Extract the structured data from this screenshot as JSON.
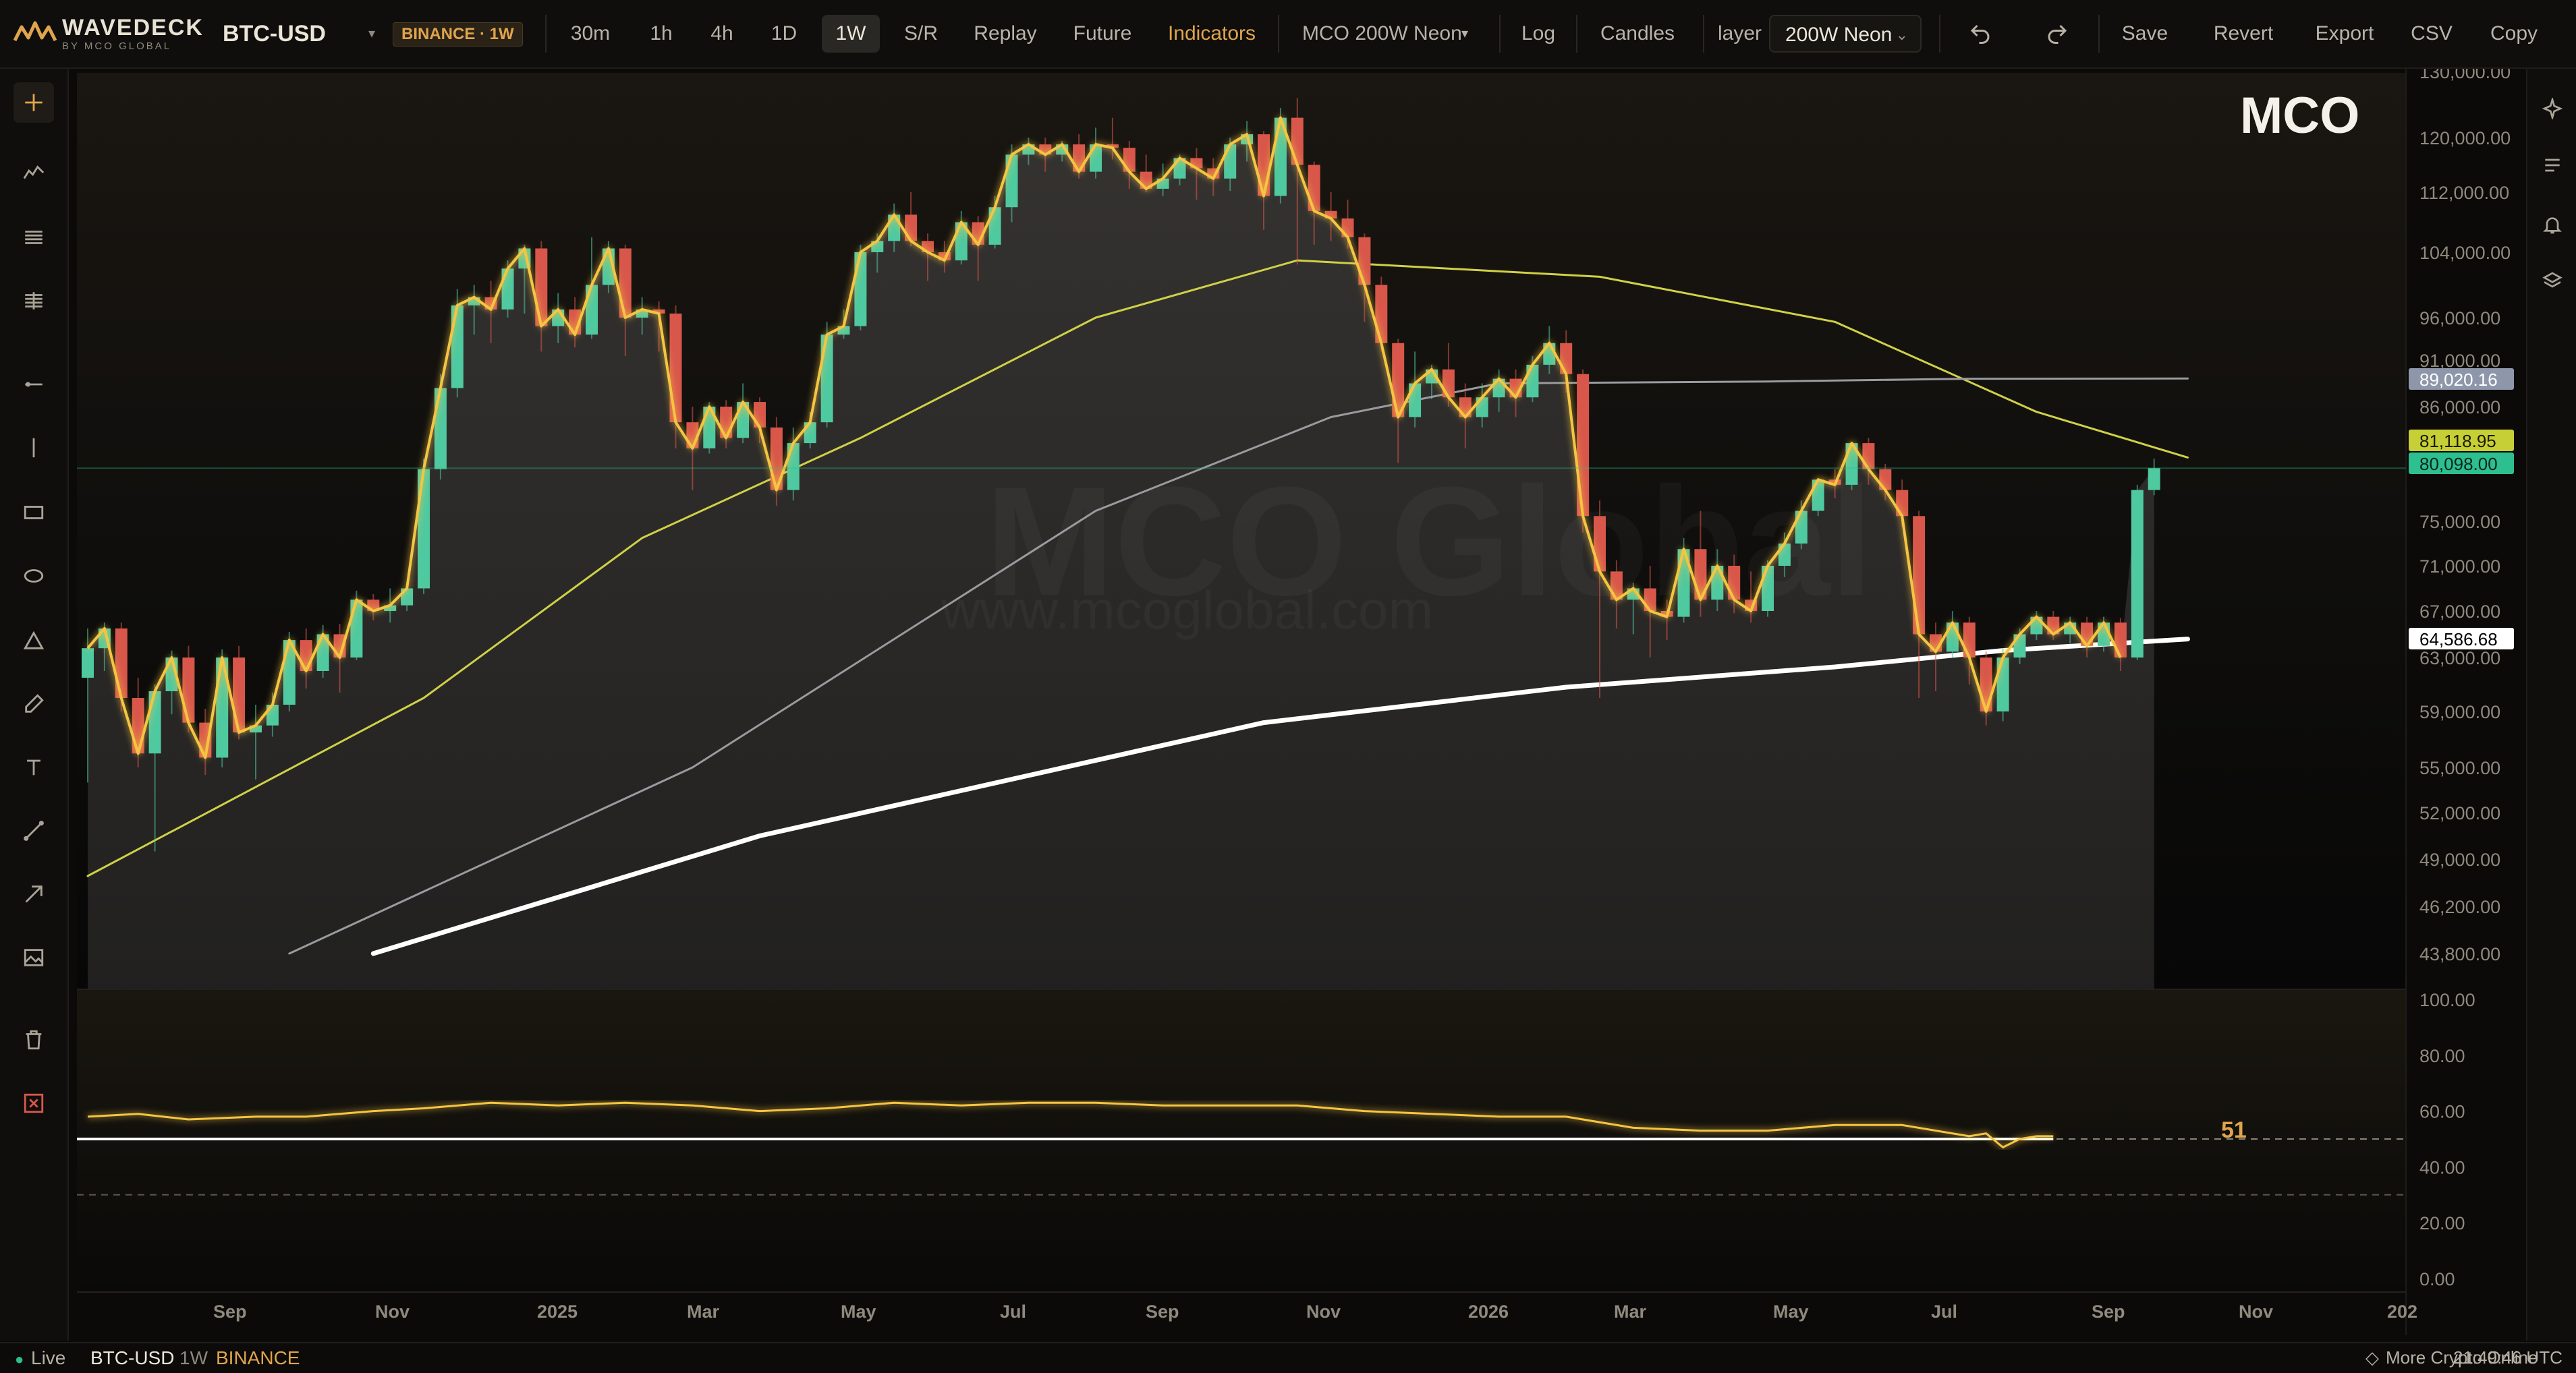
{
  "app": {
    "brand_name": "WAVEDECK",
    "brand_tagline": "BY MCO GLOBAL",
    "symbol": "BTC-USD",
    "exchange_badge": "BINANCE · 1W"
  },
  "toolbar": {
    "timeframes": [
      "30m",
      "1h",
      "4h",
      "1D",
      "1W"
    ],
    "active_timeframe": "1W",
    "buttons": {
      "sr": "S/R",
      "replay": "Replay",
      "future": "Future",
      "indicators": "Indicators"
    },
    "indicator_select": "MCO 200W Neon",
    "log": "Log",
    "candles": "Candles",
    "layer_label": "layer",
    "layer_value": "200W Neon",
    "save": "Save",
    "revert": "Revert",
    "export": "Export",
    "csv": "CSV",
    "copy": "Copy"
  },
  "left_tools": [
    "crosshair-icon",
    "polyline-icon",
    "horizontal-lines-icon",
    "fib-icon",
    "ray-icon",
    "vertical-line-icon",
    "rectangle-icon",
    "ellipse-icon",
    "triangle-icon",
    "brush-icon",
    "text-icon",
    "trendline-icon",
    "arrow-icon",
    "image-icon",
    "trash-icon",
    "close-icon"
  ],
  "right_tools": [
    "sparkle-icon",
    "list-icon",
    "bell-icon",
    "layers-icon"
  ],
  "colors": {
    "accent": "#e0a54c",
    "up_candle": "#4fc9a0",
    "down_candle": "#d8574a",
    "neon_line": "#f5c542",
    "ma_fast": "#cfd147",
    "ma_mid": "#9a9aa0",
    "ma_slow": "#ffffff",
    "tag_blue": "#8e97aa",
    "tag_green": "#2dbf8f",
    "tag_lime": "#c6cf35"
  },
  "watermark": {
    "logo": "MCO",
    "big": "MCO Global",
    "url": "www.mcoglobal.com"
  },
  "chart_data": {
    "type": "candlestick",
    "symbol": "BTC-USD",
    "interval": "1W",
    "exchange": "BINANCE",
    "price_axis_labels": [
      "130,000.00",
      "120,000.00",
      "112,000.00",
      "104,000.00",
      "96,000.00",
      "91,000.00",
      "86,000.00",
      "75,000.00",
      "71,000.00",
      "67,000.00",
      "63,000.00",
      "59,000.00",
      "55,000.00",
      "52,000.00",
      "49,000.00",
      "46,200.00",
      "43,800.00"
    ],
    "time_axis_labels": [
      "Sep",
      "Nov",
      "2025",
      "Mar",
      "May",
      "Jul",
      "Sep",
      "Nov",
      "2026",
      "Mar",
      "May",
      "Jul",
      "Sep",
      "Nov",
      "202"
    ],
    "ylim": [
      43800,
      130000
    ],
    "price_tags": [
      {
        "value": "89,020.16",
        "color": "#8e97aa",
        "text_color": "#ffffff"
      },
      {
        "value": "81,118.95",
        "color": "#c6cf35",
        "text_color": "#1a1a00"
      },
      {
        "value": "80,098.00",
        "color": "#2dbf8f",
        "text_color": "#06261b"
      },
      {
        "value": "64,586.68",
        "color": "#ffffff",
        "text_color": "#000000"
      }
    ],
    "last_price": 80098,
    "moving_averages": [
      {
        "color": "#cfd147",
        "points": [
          [
            0,
            48000
          ],
          [
            20,
            60000
          ],
          [
            33,
            73500
          ],
          [
            46,
            83000
          ],
          [
            60,
            96000
          ],
          [
            72,
            103000
          ],
          [
            90,
            101000
          ],
          [
            104,
            95500
          ],
          [
            116,
            85500
          ],
          [
            125,
            81119
          ]
        ]
      },
      {
        "color": "#9a9aa0",
        "points": [
          [
            12,
            43800
          ],
          [
            36,
            55000
          ],
          [
            60,
            76000
          ],
          [
            74,
            85000
          ],
          [
            84,
            88500
          ],
          [
            100,
            88700
          ],
          [
            112,
            89000
          ],
          [
            125,
            89020
          ]
        ]
      },
      {
        "color": "#ffffff",
        "points": [
          [
            17,
            43800
          ],
          [
            40,
            50500
          ],
          [
            70,
            58200
          ],
          [
            88,
            60800
          ],
          [
            104,
            62300
          ],
          [
            114,
            63600
          ],
          [
            125,
            64587
          ]
        ]
      }
    ],
    "candles": [
      [
        0,
        61500,
        63800,
        54000,
        65500
      ],
      [
        1,
        63800,
        65500,
        62000,
        66000
      ],
      [
        2,
        65500,
        60000,
        59000,
        66000
      ],
      [
        3,
        60000,
        56000,
        55000,
        61500
      ],
      [
        4,
        56000,
        60500,
        49500,
        61000
      ],
      [
        5,
        60500,
        63000,
        58800,
        63600
      ],
      [
        6,
        63000,
        58200,
        57500,
        64000
      ],
      [
        7,
        58200,
        55700,
        54500,
        59200
      ],
      [
        8,
        55700,
        63000,
        55000,
        63700
      ],
      [
        9,
        63000,
        57500,
        57000,
        64000
      ],
      [
        10,
        57500,
        58000,
        54200,
        59500
      ],
      [
        11,
        58000,
        59500,
        57200,
        60400
      ],
      [
        12,
        59500,
        64500,
        59000,
        65200
      ],
      [
        13,
        64500,
        62000,
        60700,
        65500
      ],
      [
        14,
        62000,
        65000,
        61500,
        65800
      ],
      [
        15,
        65000,
        63000,
        60400,
        65900
      ],
      [
        16,
        63000,
        68000,
        62800,
        68800
      ],
      [
        17,
        68000,
        67000,
        66200,
        68500
      ],
      [
        18,
        67000,
        67500,
        66000,
        69000
      ],
      [
        19,
        67500,
        69000,
        67000,
        69500
      ],
      [
        20,
        69000,
        80000,
        68500,
        81000
      ],
      [
        21,
        80000,
        88000,
        79000,
        89500
      ],
      [
        22,
        88000,
        97500,
        87000,
        99500
      ],
      [
        23,
        97500,
        98500,
        94000,
        100000
      ],
      [
        24,
        98500,
        97000,
        93000,
        100500
      ],
      [
        25,
        97000,
        102000,
        96000,
        103000
      ],
      [
        26,
        102000,
        104500,
        96500,
        105000
      ],
      [
        27,
        104500,
        95000,
        92000,
        105500
      ],
      [
        28,
        95000,
        97000,
        93000,
        99000
      ],
      [
        29,
        97000,
        94000,
        92500,
        98500
      ],
      [
        30,
        94000,
        100000,
        93500,
        106000
      ],
      [
        31,
        100000,
        104500,
        99000,
        105500
      ],
      [
        32,
        104500,
        96000,
        91500,
        105000
      ],
      [
        33,
        96000,
        97000,
        94000,
        98500
      ],
      [
        34,
        97000,
        96500,
        92000,
        98000
      ],
      [
        35,
        96500,
        84500,
        82000,
        97500
      ],
      [
        36,
        84500,
        82000,
        78000,
        86000
      ],
      [
        37,
        82000,
        86000,
        81500,
        86500
      ],
      [
        38,
        86000,
        83000,
        82000,
        86700
      ],
      [
        39,
        83000,
        86500,
        82500,
        88500
      ],
      [
        40,
        86500,
        84000,
        82500,
        87000
      ],
      [
        41,
        84000,
        78000,
        76500,
        85000
      ],
      [
        42,
        78000,
        82500,
        77000,
        84000
      ],
      [
        43,
        82500,
        84500,
        82000,
        85500
      ],
      [
        44,
        84500,
        94000,
        84000,
        95500
      ],
      [
        45,
        94000,
        95000,
        93500,
        97000
      ],
      [
        46,
        95000,
        104000,
        94500,
        105000
      ],
      [
        47,
        104000,
        105500,
        101500,
        106500
      ],
      [
        48,
        105500,
        109000,
        104000,
        110500
      ],
      [
        49,
        109000,
        105500,
        104800,
        112000
      ],
      [
        50,
        105500,
        104000,
        100500,
        106500
      ],
      [
        51,
        104000,
        103000,
        101500,
        105500
      ],
      [
        52,
        103000,
        108000,
        102500,
        109500
      ],
      [
        53,
        108000,
        105000,
        100500,
        108800
      ],
      [
        54,
        105000,
        110000,
        104500,
        111500
      ],
      [
        55,
        110000,
        117500,
        108000,
        119000
      ],
      [
        56,
        117500,
        119000,
        116000,
        120000
      ],
      [
        57,
        119000,
        117500,
        115000,
        120000
      ],
      [
        58,
        117500,
        119000,
        116500,
        119500
      ],
      [
        59,
        119000,
        115000,
        114000,
        120500
      ],
      [
        60,
        115000,
        119000,
        114000,
        121500
      ],
      [
        61,
        119000,
        118500,
        116800,
        123000
      ],
      [
        62,
        118500,
        115000,
        112500,
        119500
      ],
      [
        63,
        115000,
        112500,
        112000,
        117500
      ],
      [
        64,
        112500,
        114000,
        111500,
        116200
      ],
      [
        65,
        114000,
        117000,
        113000,
        117500
      ],
      [
        66,
        117000,
        115500,
        111000,
        118500
      ],
      [
        67,
        115500,
        114000,
        111500,
        117000
      ],
      [
        68,
        114000,
        119000,
        112200,
        120000
      ],
      [
        69,
        119000,
        120500,
        116500,
        122500
      ],
      [
        70,
        120500,
        111500,
        107000,
        121000
      ],
      [
        71,
        111500,
        123000,
        110500,
        124500
      ],
      [
        72,
        123000,
        116000,
        102500,
        126000
      ],
      [
        73,
        116000,
        109500,
        105000,
        116500
      ],
      [
        74,
        109500,
        108500,
        105500,
        112000
      ],
      [
        75,
        108500,
        106000,
        104500,
        111000
      ],
      [
        76,
        106000,
        100000,
        95500,
        106500
      ],
      [
        77,
        100000,
        93000,
        92000,
        101000
      ],
      [
        78,
        93000,
        85000,
        80600,
        93500
      ],
      [
        79,
        85000,
        88500,
        84000,
        92000
      ],
      [
        80,
        88500,
        90000,
        86800,
        90500
      ],
      [
        81,
        90000,
        87000,
        86000,
        93000
      ],
      [
        82,
        87000,
        85000,
        82000,
        88500
      ],
      [
        83,
        85000,
        87000,
        84000,
        88500
      ],
      [
        84,
        87000,
        89000,
        85500,
        90000
      ],
      [
        85,
        89000,
        87000,
        85000,
        90000
      ],
      [
        86,
        87000,
        90500,
        86500,
        91500
      ],
      [
        87,
        90500,
        93000,
        89500,
        95000
      ],
      [
        88,
        93000,
        89500,
        87500,
        94500
      ],
      [
        89,
        89500,
        75500,
        74000,
        90000
      ],
      [
        90,
        75500,
        70500,
        60000,
        77000
      ],
      [
        91,
        70500,
        68000,
        65500,
        71500
      ],
      [
        92,
        68000,
        69000,
        65000,
        69500
      ],
      [
        93,
        69000,
        67000,
        63000,
        71000
      ],
      [
        94,
        67000,
        66500,
        64500,
        68000
      ],
      [
        95,
        66500,
        72500,
        66000,
        73500
      ],
      [
        96,
        72500,
        68000,
        66500,
        76000
      ],
      [
        97,
        68000,
        71000,
        67000,
        72500
      ],
      [
        98,
        71000,
        68000,
        66800,
        72000
      ],
      [
        99,
        68000,
        67000,
        66000,
        70500
      ],
      [
        100,
        67000,
        71000,
        66500,
        71500
      ],
      [
        101,
        71000,
        73000,
        70000,
        74000
      ],
      [
        102,
        73000,
        76000,
        72500,
        77000
      ],
      [
        103,
        76000,
        79000,
        75500,
        79000
      ],
      [
        104,
        79000,
        78500,
        77200,
        80000
      ],
      [
        105,
        78500,
        82500,
        78000,
        82500
      ],
      [
        106,
        82500,
        80000,
        78500,
        83000
      ],
      [
        107,
        80000,
        78000,
        77000,
        80500
      ],
      [
        108,
        78000,
        75500,
        74500,
        79000
      ],
      [
        109,
        75500,
        65000,
        60000,
        76000
      ],
      [
        110,
        65000,
        63500,
        60500,
        66000
      ],
      [
        111,
        63500,
        66000,
        63000,
        67000
      ],
      [
        112,
        66000,
        63000,
        61000,
        66500
      ],
      [
        113,
        63000,
        59000,
        58000,
        63500
      ],
      [
        114,
        59000,
        63000,
        58300,
        63800
      ],
      [
        115,
        63000,
        65000,
        62500,
        65500
      ],
      [
        116,
        65000,
        66500,
        64500,
        67000
      ],
      [
        117,
        66500,
        65000,
        64500,
        67000
      ],
      [
        118,
        65000,
        66000,
        64200,
        66500
      ],
      [
        119,
        66000,
        64000,
        63000,
        66500
      ],
      [
        120,
        64000,
        66000,
        63500,
        66500
      ],
      [
        121,
        66000,
        63000,
        62000,
        66400
      ],
      [
        122,
        63000,
        78000,
        62800,
        78500
      ],
      [
        123,
        78000,
        80098,
        77500,
        81000
      ]
    ],
    "rsi": {
      "ylim": [
        0,
        100
      ],
      "axis_labels": [
        "100.00",
        "80.00",
        "60.00",
        "40.00",
        "20.00",
        "0.00"
      ],
      "level_high": 50,
      "level_low": 30,
      "current": "51",
      "points": [
        [
          0,
          58
        ],
        [
          3,
          59
        ],
        [
          6,
          57
        ],
        [
          10,
          58
        ],
        [
          13,
          58
        ],
        [
          17,
          60
        ],
        [
          20,
          61
        ],
        [
          24,
          63
        ],
        [
          28,
          62
        ],
        [
          32,
          63
        ],
        [
          36,
          62
        ],
        [
          40,
          60
        ],
        [
          44,
          61
        ],
        [
          48,
          63
        ],
        [
          52,
          62
        ],
        [
          56,
          63
        ],
        [
          60,
          63
        ],
        [
          64,
          62
        ],
        [
          68,
          62
        ],
        [
          72,
          62
        ],
        [
          76,
          60
        ],
        [
          80,
          59
        ],
        [
          84,
          58
        ],
        [
          88,
          58
        ],
        [
          92,
          54
        ],
        [
          96,
          53
        ],
        [
          100,
          53
        ],
        [
          104,
          55
        ],
        [
          108,
          55
        ],
        [
          112,
          51
        ],
        [
          113,
          52
        ],
        [
          114,
          47
        ],
        [
          115,
          50
        ],
        [
          116,
          51
        ],
        [
          117,
          51
        ]
      ]
    }
  },
  "statusbar": {
    "live": "Live",
    "symbol": "BTC-USD",
    "interval": "1W",
    "exchange": "BINANCE",
    "credit": "More Crypto Online",
    "time": "21:49:46 UTC"
  }
}
